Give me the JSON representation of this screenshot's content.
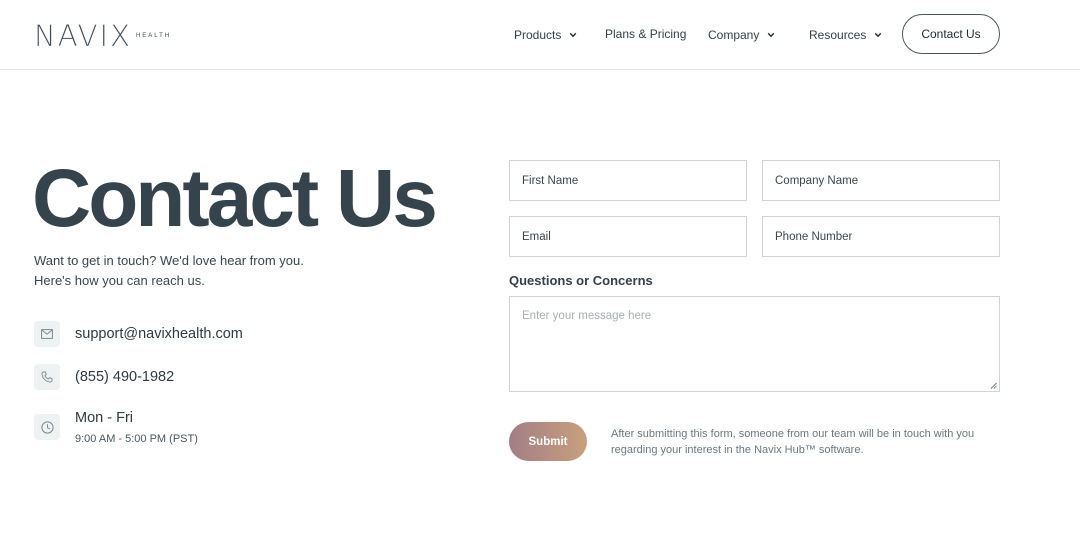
{
  "brand": {
    "name": "NAVIX",
    "sub": "HEALTH"
  },
  "nav": {
    "products": "Products",
    "plans": "Plans & Pricing",
    "company": "Company",
    "resources": "Resources",
    "contact_button": "Contact Us"
  },
  "hero": {
    "title": "Contact Us",
    "intro_line1": "Want to get in touch? We'd love hear from you.",
    "intro_line2": "Here's how you can reach us."
  },
  "contact": {
    "email": "support@navixhealth.com",
    "phone": "(855) 490-1982",
    "days": "Mon - Fri",
    "hours": "9:00 AM  - 5:00 PM (PST)"
  },
  "form": {
    "first_name": "First Name",
    "company_name": "Company Name",
    "email": "Email",
    "phone": "Phone Number",
    "questions_label": "Questions or Concerns",
    "message_placeholder": "Enter your message here",
    "submit": "Submit",
    "note": "After submitting this form, someone from our team will be in touch with you regarding your interest in the Navix Hub™ software."
  },
  "colors": {
    "text": "#34434c",
    "submit_start": "#a27e87",
    "submit_end": "#c9a07c",
    "border": "#cfd4d7"
  },
  "icons": [
    "chevron-down-icon",
    "mail-icon",
    "phone-icon",
    "clock-icon"
  ]
}
